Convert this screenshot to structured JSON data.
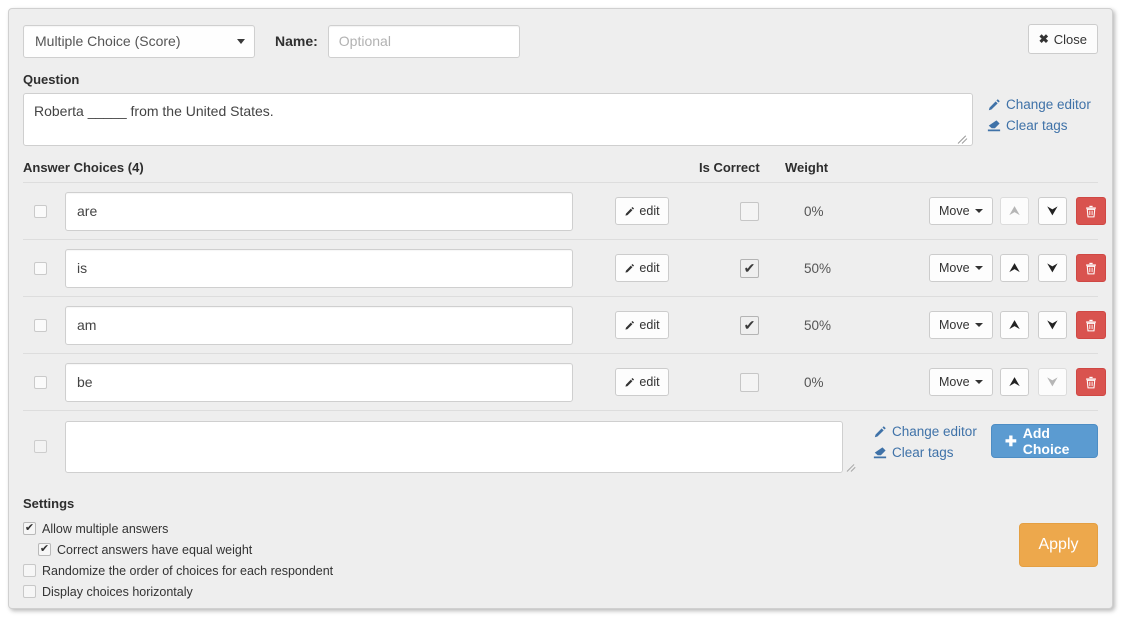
{
  "toolbar": {
    "question_type": "Multiple Choice (Score)",
    "name_label": "Name:",
    "name_value": "",
    "name_placeholder": "Optional",
    "close_label": "Close",
    "close_icon": "close-x-icon"
  },
  "question": {
    "section_label": "Question",
    "text": "Roberta _____ from the United States.",
    "change_editor_label": "Change editor",
    "clear_tags_label": "Clear tags",
    "change_editor_icon": "pencil-icon",
    "clear_tags_icon": "eraser-icon"
  },
  "choices": {
    "header": "Answer Choices (4)",
    "col_is_correct": "Is Correct",
    "col_weight": "Weight",
    "edit_label": "edit",
    "move_label": "Move",
    "up_icon": "arrow-up-icon",
    "down_icon": "arrow-down-icon",
    "delete_icon": "trash-icon",
    "rows": [
      {
        "text": "are",
        "is_correct": false,
        "weight": "0%",
        "up_disabled": true,
        "down_disabled": false
      },
      {
        "text": "is",
        "is_correct": true,
        "weight": "50%",
        "up_disabled": false,
        "down_disabled": false
      },
      {
        "text": "am",
        "is_correct": true,
        "weight": "50%",
        "up_disabled": false,
        "down_disabled": false
      },
      {
        "text": "be",
        "is_correct": false,
        "weight": "0%",
        "up_disabled": false,
        "down_disabled": true
      }
    ]
  },
  "new_choice": {
    "text": "",
    "placeholder": "",
    "change_editor_label": "Change editor",
    "clear_tags_label": "Clear tags",
    "add_choice_label": "Add Choice",
    "add_choice_icon": "plus-icon"
  },
  "settings": {
    "title": "Settings",
    "items": [
      {
        "label": "Allow multiple answers",
        "checked": true,
        "indented": false
      },
      {
        "label": "Correct answers have equal weight",
        "checked": true,
        "indented": true
      },
      {
        "label": "Randomize the order of choices for each respondent",
        "checked": false,
        "indented": false
      },
      {
        "label": "Display choices horizontaly",
        "checked": false,
        "indented": false
      }
    ]
  },
  "apply": {
    "label": "Apply"
  },
  "colors": {
    "panel_bg": "#eeeeee",
    "link_blue": "#3f72a8",
    "add_choice_blue": "#5b9bd1",
    "delete_red": "#d9534f",
    "apply_orange": "#eda84c"
  }
}
